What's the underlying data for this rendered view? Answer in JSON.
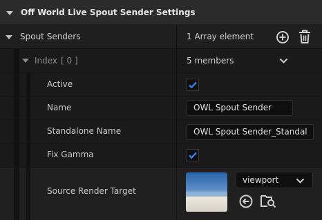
{
  "header": {
    "title": "Off World Live Spout Sender Settings"
  },
  "spout_senders": {
    "label": "Spout Senders",
    "count_text": "1 Array element"
  },
  "index_row": {
    "label": "Index",
    "index_value": "[ 0 ]",
    "members_text": "5 members"
  },
  "properties": {
    "active": {
      "label": "Active",
      "checked": true
    },
    "name": {
      "label": "Name",
      "value": "OWL Spout Sender"
    },
    "standalone_name": {
      "label": "Standalone Name",
      "value": "OWL Spout Sender_Standal"
    },
    "fix_gamma": {
      "label": "Fix Gamma",
      "checked": true
    },
    "source_render_target": {
      "label": "Source Render Target",
      "combo_value": "viewport"
    }
  },
  "icons": [
    "collapse-arrow-icon",
    "add-icon",
    "trash-icon",
    "chevron-down-icon",
    "checkmark-icon",
    "use-selected-icon",
    "browse-icon"
  ],
  "colors": {
    "check": "#2f83e8",
    "panel": "#1a1a1a",
    "header": "#2b2b2b"
  }
}
